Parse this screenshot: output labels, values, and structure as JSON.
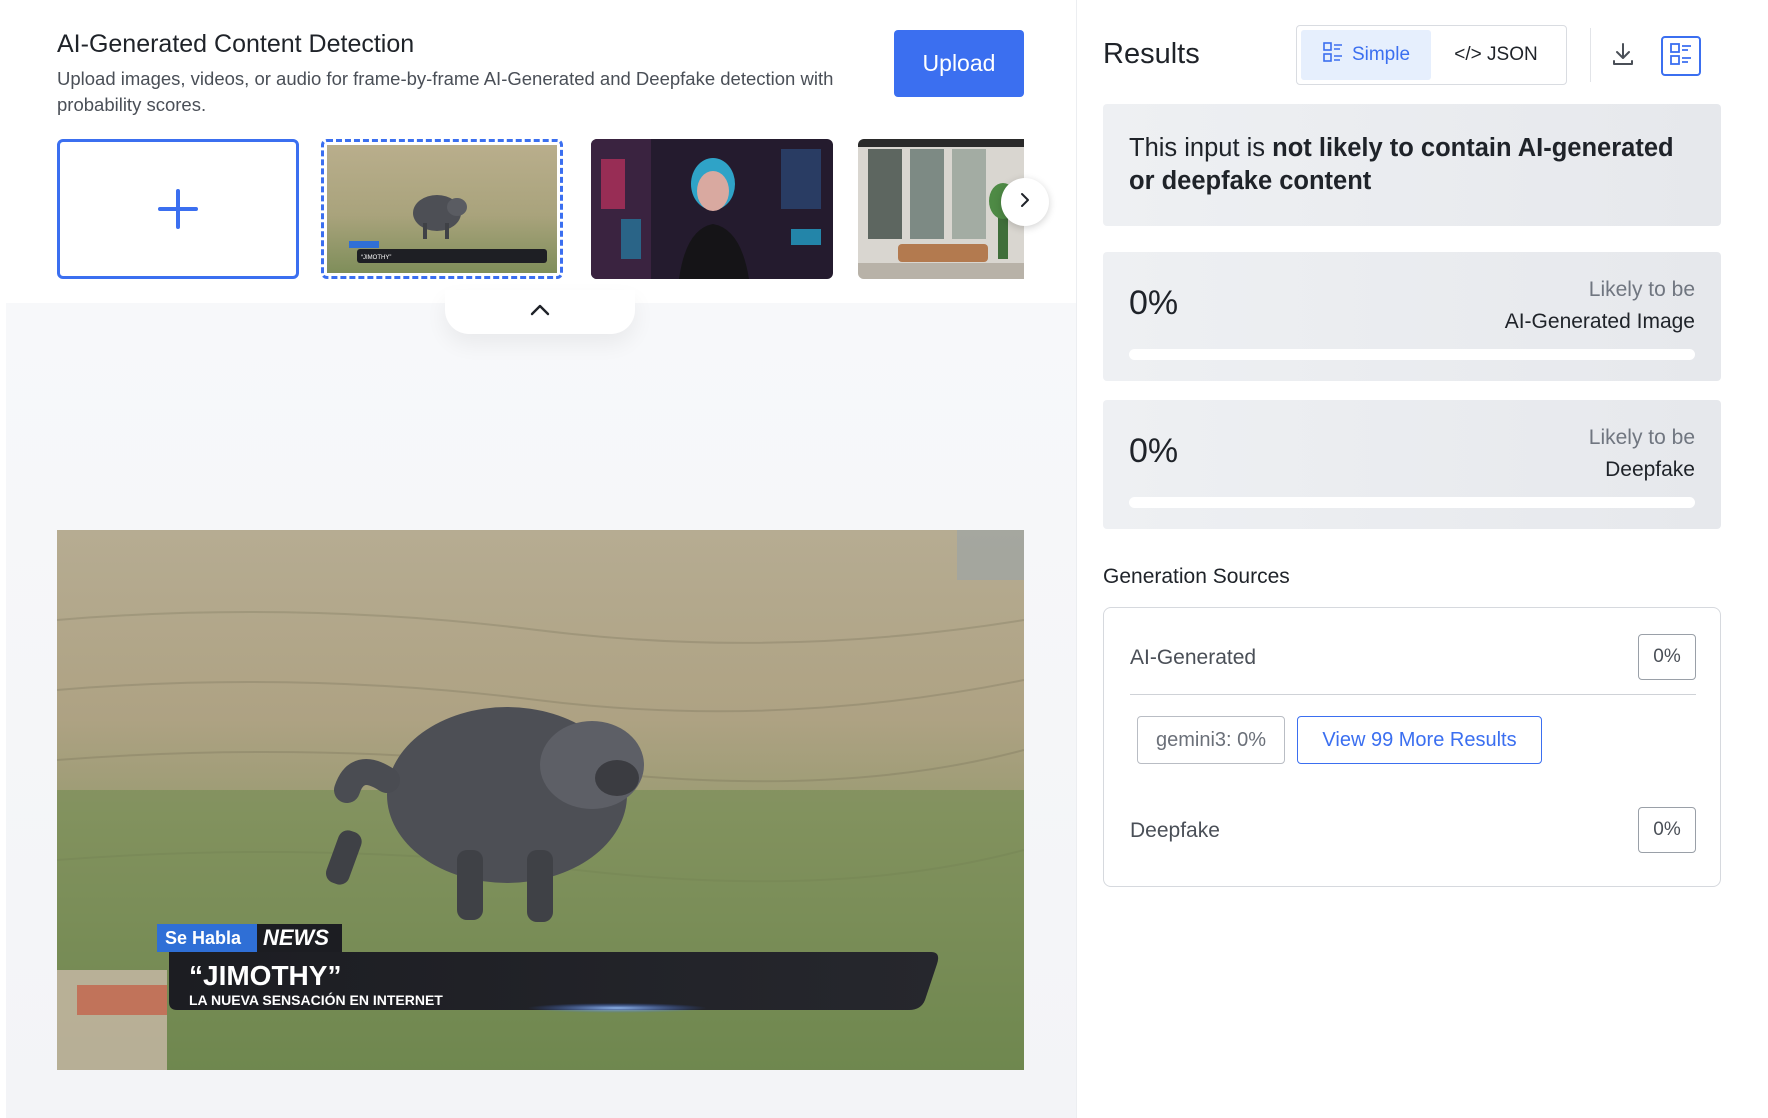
{
  "header": {
    "title": "AI-Generated Content Detection",
    "subtitle": "Upload images, videos, or audio for frame-by-frame AI-Generated and Deepfake detection with probability scores.",
    "upload_label": "Upload"
  },
  "thumbnails": {
    "add_icon": "plus-icon",
    "selected_caption_brand": "Se Habla NEWS",
    "selected_caption_title": "“JIMOTHY”",
    "selected_caption_sub": "LA NUEVA SENSACIÓN EN INTERNET"
  },
  "preview": {
    "brand_left": "Se Habla",
    "brand_right": "NEWS",
    "headline": "“JIMOTHY”",
    "subline": "LA NUEVA SENSACIÓN EN INTERNET"
  },
  "results": {
    "title": "Results",
    "toggle": {
      "simple": "Simple",
      "json": "</> JSON",
      "active": "simple"
    },
    "verdict_prefix": "This input is ",
    "verdict_bold": "not likely to contain AI-generated or deepfake content",
    "scores": [
      {
        "percent": "0%",
        "value": 0,
        "caption": "Likely to be",
        "label": "AI-Generated Image"
      },
      {
        "percent": "0%",
        "value": 0,
        "caption": "Likely to be",
        "label": "Deepfake"
      }
    ]
  },
  "generation_sources": {
    "title": "Generation Sources",
    "ai_label": "AI-Generated",
    "ai_percent": "0%",
    "model_chip": "gemini3: 0%",
    "more_label": "View 99 More Results",
    "deepfake_label": "Deepfake",
    "deepfake_percent": "0%"
  },
  "colors": {
    "accent": "#3b6ff0",
    "card_bg": "#e9ebef"
  }
}
